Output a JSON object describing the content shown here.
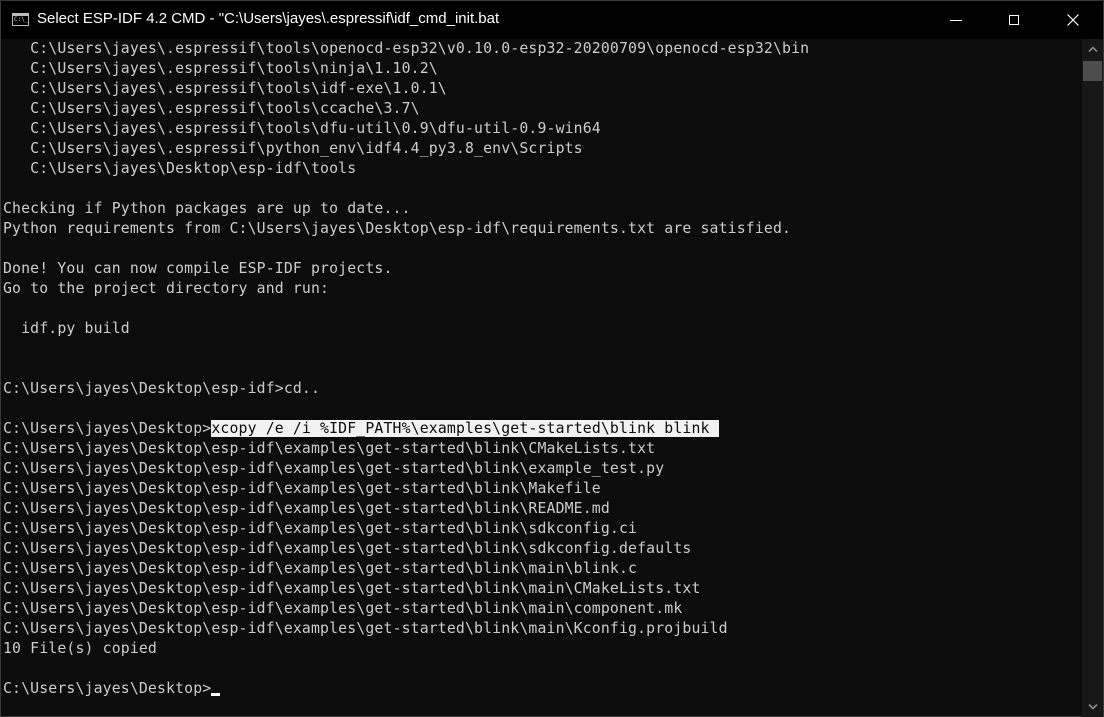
{
  "window": {
    "title": "Select ESP-IDF 4.2 CMD - \"C:\\Users\\jayes\\.espressif\\idf_cmd_init.bat",
    "icon_label": "C:\\_",
    "controls": {
      "minimize": "minimize-icon",
      "maximize": "maximize-icon",
      "close": "close-icon"
    }
  },
  "terminal": {
    "lines": [
      "   C:\\Users\\jayes\\.espressif\\tools\\openocd-esp32\\v0.10.0-esp32-20200709\\openocd-esp32\\bin",
      "   C:\\Users\\jayes\\.espressif\\tools\\ninja\\1.10.2\\",
      "   C:\\Users\\jayes\\.espressif\\tools\\idf-exe\\1.0.1\\",
      "   C:\\Users\\jayes\\.espressif\\tools\\ccache\\3.7\\",
      "   C:\\Users\\jayes\\.espressif\\tools\\dfu-util\\0.9\\dfu-util-0.9-win64",
      "   C:\\Users\\jayes\\.espressif\\python_env\\idf4.4_py3.8_env\\Scripts",
      "   C:\\Users\\jayes\\Desktop\\esp-idf\\tools",
      "",
      "Checking if Python packages are up to date...",
      "Python requirements from C:\\Users\\jayes\\Desktop\\esp-idf\\requirements.txt are satisfied.",
      "",
      "Done! You can now compile ESP-IDF projects.",
      "Go to the project directory and run:",
      "",
      "  idf.py build",
      "",
      "",
      "C:\\Users\\jayes\\Desktop\\esp-idf>cd..",
      "",
      "",
      "C:\\Users\\jayes\\Desktop\\esp-idf\\examples\\get-started\\blink\\CMakeLists.txt",
      "C:\\Users\\jayes\\Desktop\\esp-idf\\examples\\get-started\\blink\\example_test.py",
      "C:\\Users\\jayes\\Desktop\\esp-idf\\examples\\get-started\\blink\\Makefile",
      "C:\\Users\\jayes\\Desktop\\esp-idf\\examples\\get-started\\blink\\README.md",
      "C:\\Users\\jayes\\Desktop\\esp-idf\\examples\\get-started\\blink\\sdkconfig.ci",
      "C:\\Users\\jayes\\Desktop\\esp-idf\\examples\\get-started\\blink\\sdkconfig.defaults",
      "C:\\Users\\jayes\\Desktop\\esp-idf\\examples\\get-started\\blink\\main\\blink.c",
      "C:\\Users\\jayes\\Desktop\\esp-idf\\examples\\get-started\\blink\\main\\CMakeLists.txt",
      "C:\\Users\\jayes\\Desktop\\esp-idf\\examples\\get-started\\blink\\main\\component.mk",
      "C:\\Users\\jayes\\Desktop\\esp-idf\\examples\\get-started\\blink\\main\\Kconfig.projbuild",
      "10 File(s) copied",
      "",
      "C:\\Users\\jayes\\Desktop>"
    ],
    "xcopy_prompt": "C:\\Users\\jayes\\Desktop>",
    "xcopy_selected_command": "xcopy /e /i %IDF_PATH%\\examples\\get-started\\blink blink ",
    "colors": {
      "background": "#0c0c0c",
      "foreground": "#cccccc",
      "selection": "#f2f2f2"
    }
  }
}
